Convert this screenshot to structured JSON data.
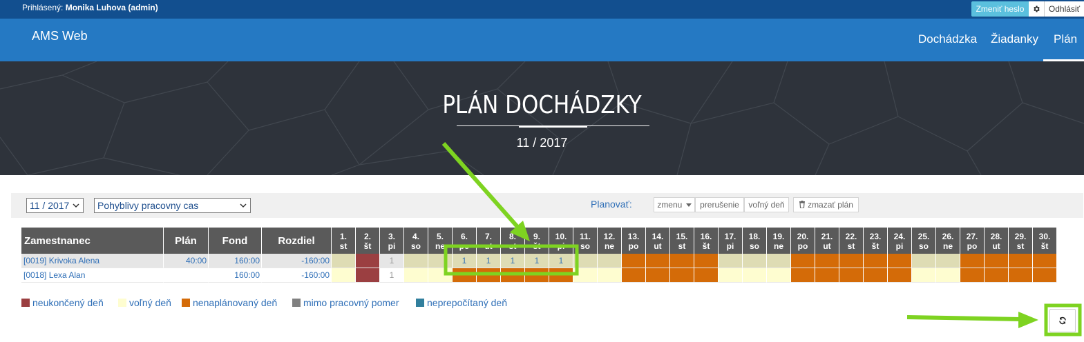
{
  "topbar": {
    "user_prefix": "Prihlásený:",
    "user_name": "Monika Luhova (admin)",
    "change_password": "Zmeniť heslo",
    "logout": "Odhlásiť"
  },
  "nav": {
    "brand": "AMS Web",
    "items": [
      {
        "label": "Dochádzka"
      },
      {
        "label": "Žiadanky"
      },
      {
        "label": "Plán",
        "active": true
      }
    ]
  },
  "hero": {
    "title": "PLÁN DOCHÁDZKY",
    "subtitle": "11 / 2017"
  },
  "filters": {
    "month": "11 / 2017",
    "schedule": "Pohyblivy pracovny cas",
    "plan_label": "Planovať:",
    "buttons": {
      "shift": "zmenu",
      "break": "prerušenie",
      "free_day": "voľný deň",
      "delete": "zmazať plán"
    }
  },
  "table": {
    "headers": {
      "employee": "Zamestnanec",
      "plan": "Plán",
      "fund": "Fond",
      "diff": "Rozdiel"
    },
    "days": [
      {
        "n": "1.",
        "d": "st"
      },
      {
        "n": "2.",
        "d": "št"
      },
      {
        "n": "3.",
        "d": "pi"
      },
      {
        "n": "4.",
        "d": "so"
      },
      {
        "n": "5.",
        "d": "ne"
      },
      {
        "n": "6.",
        "d": "po"
      },
      {
        "n": "7.",
        "d": "ut"
      },
      {
        "n": "8.",
        "d": "st"
      },
      {
        "n": "9.",
        "d": "št"
      },
      {
        "n": "10.",
        "d": "pi"
      },
      {
        "n": "11.",
        "d": "so"
      },
      {
        "n": "12.",
        "d": "ne"
      },
      {
        "n": "13.",
        "d": "po"
      },
      {
        "n": "14.",
        "d": "ut"
      },
      {
        "n": "15.",
        "d": "st"
      },
      {
        "n": "16.",
        "d": "št"
      },
      {
        "n": "17.",
        "d": "pi"
      },
      {
        "n": "18.",
        "d": "so"
      },
      {
        "n": "19.",
        "d": "ne"
      },
      {
        "n": "20.",
        "d": "po"
      },
      {
        "n": "21.",
        "d": "ut"
      },
      {
        "n": "22.",
        "d": "st"
      },
      {
        "n": "23.",
        "d": "št"
      },
      {
        "n": "24.",
        "d": "pi"
      },
      {
        "n": "25.",
        "d": "so"
      },
      {
        "n": "26.",
        "d": "ne"
      },
      {
        "n": "27.",
        "d": "po"
      },
      {
        "n": "28.",
        "d": "ut"
      },
      {
        "n": "29.",
        "d": "st"
      },
      {
        "n": "30.",
        "d": "št"
      }
    ],
    "rows": [
      {
        "name": "[0019] Krivoka Alena",
        "plan": "40:00",
        "fund": "160:00",
        "diff": "-160:00",
        "cells": [
          {
            "t": "",
            "s": "free"
          },
          {
            "t": "",
            "s": "unfinished"
          },
          {
            "t": "1",
            "s": "plain"
          },
          {
            "t": "",
            "s": "free"
          },
          {
            "t": "",
            "s": "free"
          },
          {
            "t": "1",
            "s": "free"
          },
          {
            "t": "1",
            "s": "free"
          },
          {
            "t": "1",
            "s": "free"
          },
          {
            "t": "1",
            "s": "free"
          },
          {
            "t": "1",
            "s": "free"
          },
          {
            "t": "",
            "s": "free"
          },
          {
            "t": "",
            "s": "free"
          },
          {
            "t": "",
            "s": "unplanned"
          },
          {
            "t": "",
            "s": "unplanned"
          },
          {
            "t": "",
            "s": "unplanned"
          },
          {
            "t": "",
            "s": "unplanned"
          },
          {
            "t": "",
            "s": "free"
          },
          {
            "t": "",
            "s": "free"
          },
          {
            "t": "",
            "s": "free"
          },
          {
            "t": "",
            "s": "unplanned"
          },
          {
            "t": "",
            "s": "unplanned"
          },
          {
            "t": "",
            "s": "unplanned"
          },
          {
            "t": "",
            "s": "unplanned"
          },
          {
            "t": "",
            "s": "unplanned"
          },
          {
            "t": "",
            "s": "free"
          },
          {
            "t": "",
            "s": "free"
          },
          {
            "t": "",
            "s": "unplanned"
          },
          {
            "t": "",
            "s": "unplanned"
          },
          {
            "t": "",
            "s": "unplanned"
          },
          {
            "t": "",
            "s": "unplanned"
          }
        ]
      },
      {
        "name": "[0018] Lexa Alan",
        "plan": "",
        "fund": "160:00",
        "diff": "-160:00",
        "cells": [
          {
            "t": "",
            "s": "free"
          },
          {
            "t": "",
            "s": "unfinished"
          },
          {
            "t": "1",
            "s": "plain"
          },
          {
            "t": "",
            "s": "free"
          },
          {
            "t": "",
            "s": "free"
          },
          {
            "t": "",
            "s": "unplanned"
          },
          {
            "t": "",
            "s": "unplanned"
          },
          {
            "t": "",
            "s": "unplanned"
          },
          {
            "t": "",
            "s": "unplanned"
          },
          {
            "t": "",
            "s": "unplanned"
          },
          {
            "t": "",
            "s": "free"
          },
          {
            "t": "",
            "s": "free"
          },
          {
            "t": "",
            "s": "unplanned"
          },
          {
            "t": "",
            "s": "unplanned"
          },
          {
            "t": "",
            "s": "unplanned"
          },
          {
            "t": "",
            "s": "unplanned"
          },
          {
            "t": "",
            "s": "free"
          },
          {
            "t": "",
            "s": "free"
          },
          {
            "t": "",
            "s": "free"
          },
          {
            "t": "",
            "s": "unplanned"
          },
          {
            "t": "",
            "s": "unplanned"
          },
          {
            "t": "",
            "s": "unplanned"
          },
          {
            "t": "",
            "s": "unplanned"
          },
          {
            "t": "",
            "s": "unplanned"
          },
          {
            "t": "",
            "s": "free"
          },
          {
            "t": "",
            "s": "free"
          },
          {
            "t": "",
            "s": "unplanned"
          },
          {
            "t": "",
            "s": "unplanned"
          },
          {
            "t": "",
            "s": "unplanned"
          },
          {
            "t": "",
            "s": "unplanned"
          }
        ]
      }
    ]
  },
  "legend": [
    {
      "label": "neukončený deň",
      "color": "#9b3f41"
    },
    {
      "label": "voľný deň",
      "color": "#fefdd0"
    },
    {
      "label": "nenaplánovaný deň",
      "color": "#d46b08"
    },
    {
      "label": "mimo pracovný pomer",
      "color": "#808080"
    },
    {
      "label": "neprepočítaný deň",
      "color": "#317f9d"
    }
  ],
  "colors": {
    "free": "#fefdd0",
    "free_selected": "#dedcb4",
    "unfinished": "#9b3f41",
    "unplanned": "#d46b08",
    "plain": "#ffffff",
    "plain_selected": "#e6e6e6",
    "highlight": "#7ed321"
  }
}
